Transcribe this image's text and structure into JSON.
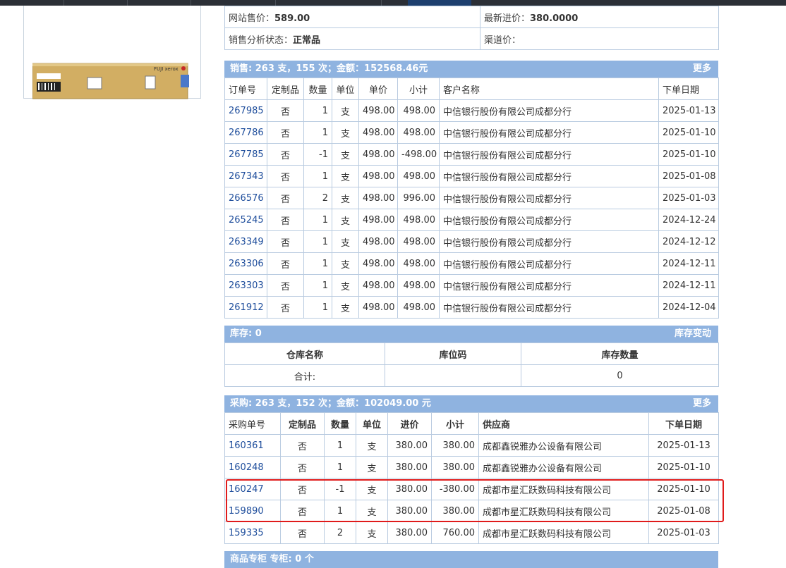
{
  "info": {
    "price_label": "网站售价：",
    "price_value": "589.00",
    "cost_label": "最新进价：",
    "cost_value": "380.0000",
    "status_label": "销售分析状态：",
    "status_value": "正常品",
    "channel_label": "渠道价："
  },
  "sales": {
    "header": "销售:  263 支，155 次；金额：152568.46元",
    "more": "更多",
    "columns": [
      "订单号",
      "定制品",
      "数量",
      "单位",
      "单价",
      "小计",
      "客户名称",
      "下单日期"
    ],
    "rows": [
      [
        "267985",
        "否",
        "1",
        "支",
        "498.00",
        "498.00",
        "中信银行股份有限公司成都分行",
        "2025-01-13"
      ],
      [
        "267786",
        "否",
        "1",
        "支",
        "498.00",
        "498.00",
        "中信银行股份有限公司成都分行",
        "2025-01-10"
      ],
      [
        "267785",
        "否",
        "-1",
        "支",
        "498.00",
        "-498.00",
        "中信银行股份有限公司成都分行",
        "2025-01-10"
      ],
      [
        "267343",
        "否",
        "1",
        "支",
        "498.00",
        "498.00",
        "中信银行股份有限公司成都分行",
        "2025-01-08"
      ],
      [
        "266576",
        "否",
        "2",
        "支",
        "498.00",
        "996.00",
        "中信银行股份有限公司成都分行",
        "2025-01-03"
      ],
      [
        "265245",
        "否",
        "1",
        "支",
        "498.00",
        "498.00",
        "中信银行股份有限公司成都分行",
        "2024-12-24"
      ],
      [
        "263349",
        "否",
        "1",
        "支",
        "498.00",
        "498.00",
        "中信银行股份有限公司成都分行",
        "2024-12-12"
      ],
      [
        "263306",
        "否",
        "1",
        "支",
        "498.00",
        "498.00",
        "中信银行股份有限公司成都分行",
        "2024-12-11"
      ],
      [
        "263303",
        "否",
        "1",
        "支",
        "498.00",
        "498.00",
        "中信银行股份有限公司成都分行",
        "2024-12-11"
      ],
      [
        "261912",
        "否",
        "1",
        "支",
        "498.00",
        "498.00",
        "中信银行股份有限公司成都分行",
        "2024-12-04"
      ]
    ]
  },
  "stock": {
    "header": "库存:  0",
    "more": "库存变动",
    "columns": [
      "仓库名称",
      "库位码",
      "库存数量"
    ],
    "total_label": "合计:",
    "total_value": "0"
  },
  "purchase": {
    "header": "采购:  263 支，152 次；金额：102049.00 元",
    "more": "更多",
    "columns": [
      "采购单号",
      "定制品",
      "数量",
      "单位",
      "进价",
      "小计",
      "供应商",
      "下单日期"
    ],
    "rows": [
      [
        "160361",
        "否",
        "1",
        "支",
        "380.00",
        "380.00",
        "成都鑫锐雅办公设备有限公司",
        "2025-01-13"
      ],
      [
        "160248",
        "否",
        "1",
        "支",
        "380.00",
        "380.00",
        "成都鑫锐雅办公设备有限公司",
        "2025-01-10"
      ],
      [
        "160247",
        "否",
        "-1",
        "支",
        "380.00",
        "-380.00",
        "成都市星汇跃数码科技有限公司",
        "2025-01-10"
      ],
      [
        "159890",
        "否",
        "1",
        "支",
        "380.00",
        "380.00",
        "成都市星汇跃数码科技有限公司",
        "2025-01-08"
      ],
      [
        "159335",
        "否",
        "2",
        "支",
        "380.00",
        "760.00",
        "成都市星汇跃数码科技有限公司",
        "2025-01-03"
      ]
    ]
  },
  "next_panel": {
    "header": "商品专柜    专柜: 0 个"
  },
  "product_image": {
    "brand": "FUJI xerox",
    "icon": "toner-cartridge-image"
  },
  "colors": {
    "panel_header": "#8fb3e0",
    "border": "#b9cbe0",
    "link": "#1f4e9c",
    "highlight": "#e01b1b"
  }
}
